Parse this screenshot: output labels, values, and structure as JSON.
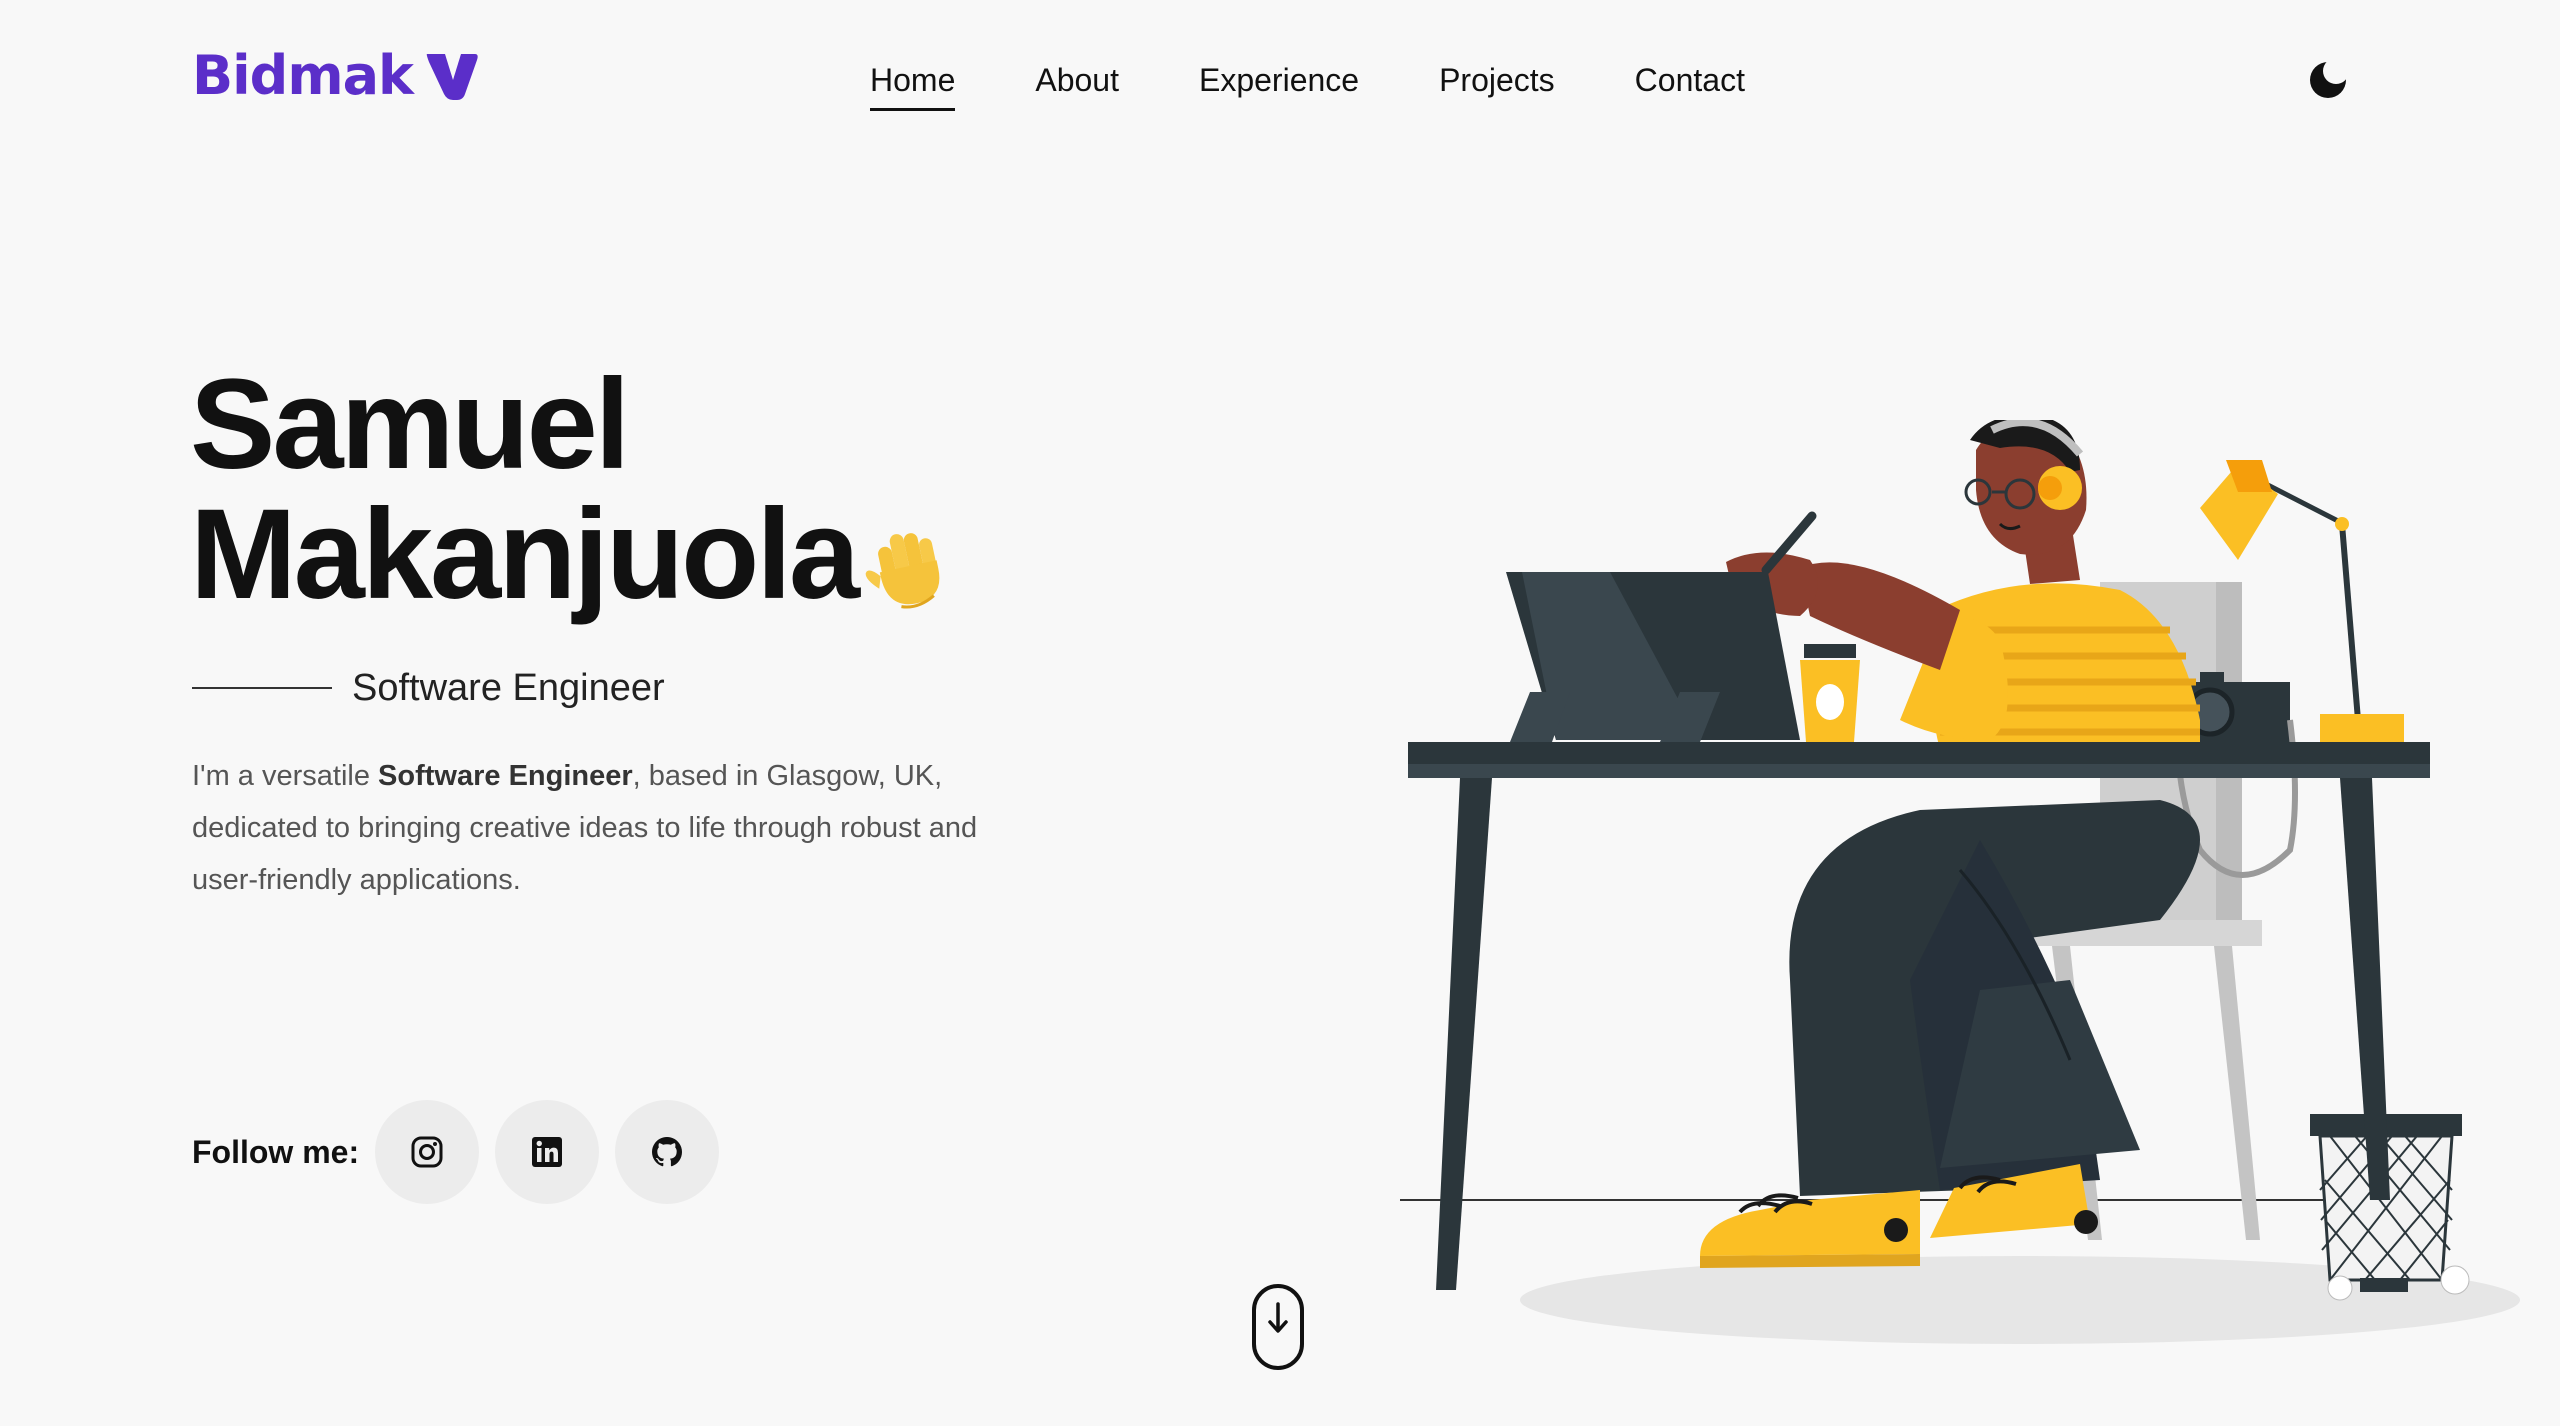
{
  "nav": {
    "logo_text": "Bidmak",
    "links": [
      {
        "label": "Home",
        "active": true
      },
      {
        "label": "About",
        "active": false
      },
      {
        "label": "Experience",
        "active": false
      },
      {
        "label": "Projects",
        "active": false
      },
      {
        "label": "Contact",
        "active": false
      }
    ],
    "theme_toggle_icon": "moon-icon"
  },
  "hero": {
    "first_name": "Samuel",
    "last_name": "Makanjuola",
    "wave_icon": "waving-hand-icon",
    "role": "Software Engineer",
    "bio_prefix": "I'm a versatile ",
    "bio_highlight": "Software Engineer",
    "bio_suffix": ", based in Glasgow, UK, dedicated to bringing creative ideas to life through robust and user-friendly applications."
  },
  "social": {
    "label": "Follow me:",
    "links": [
      {
        "icon": "instagram-icon"
      },
      {
        "icon": "linkedin-icon"
      },
      {
        "icon": "github-icon"
      }
    ]
  },
  "scroll": {
    "icon": "arrow-down-icon"
  },
  "colors": {
    "brand": "#5b2ec9",
    "background": "#f8f8f8",
    "accent_yellow": "#fbbf24",
    "desk": "#2b363b"
  }
}
